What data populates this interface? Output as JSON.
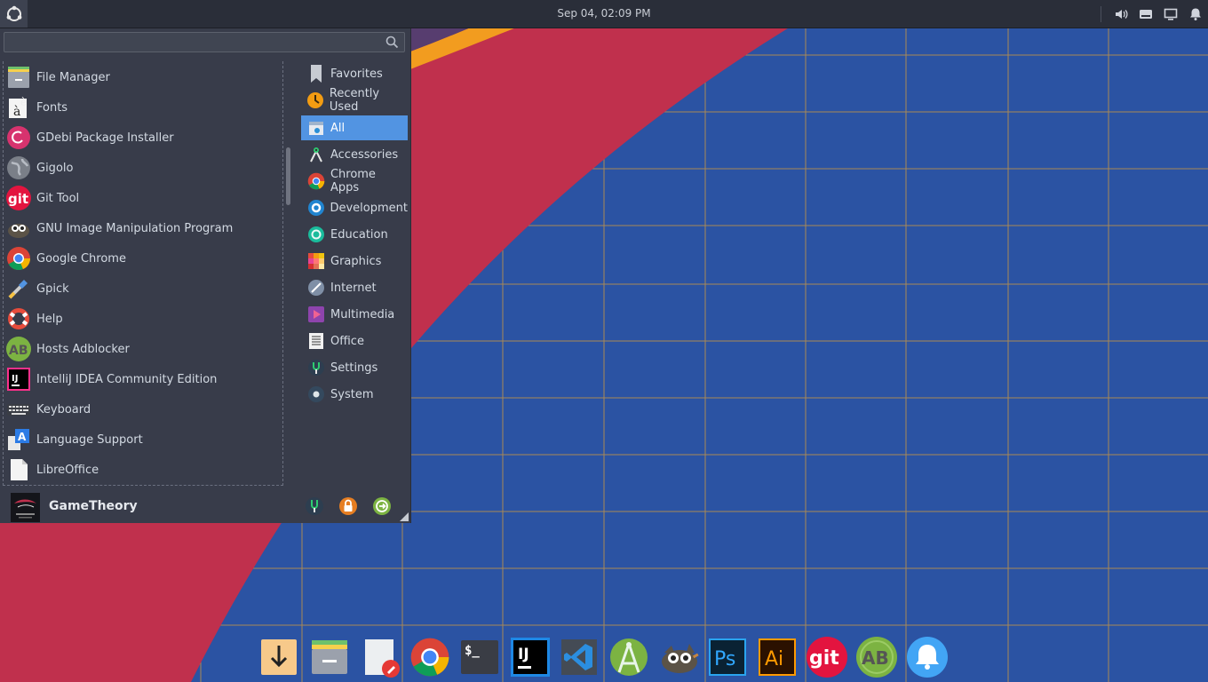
{
  "panel": {
    "clock": "Sep 04, 02:09 PM"
  },
  "search": {
    "value": "",
    "placeholder": ""
  },
  "apps": [
    {
      "label": "File Manager",
      "icon": "file-manager-icon"
    },
    {
      "label": "Fonts",
      "icon": "fonts-icon"
    },
    {
      "label": "GDebi Package Installer",
      "icon": "gdebi-icon"
    },
    {
      "label": "Gigolo",
      "icon": "gigolo-icon"
    },
    {
      "label": "Git Tool",
      "icon": "git-icon"
    },
    {
      "label": "GNU Image Manipulation Program",
      "icon": "gimp-icon"
    },
    {
      "label": "Google Chrome",
      "icon": "chrome-icon"
    },
    {
      "label": "Gpick",
      "icon": "gpick-icon"
    },
    {
      "label": "Help",
      "icon": "help-icon"
    },
    {
      "label": "Hosts Adblocker",
      "icon": "adblocker-icon"
    },
    {
      "label": "IntelliJ IDEA Community Edition",
      "icon": "intellij-icon"
    },
    {
      "label": "Keyboard",
      "icon": "keyboard-icon"
    },
    {
      "label": "Language Support",
      "icon": "language-icon"
    },
    {
      "label": "LibreOffice",
      "icon": "libreoffice-icon"
    }
  ],
  "categories": [
    {
      "label": "Favorites",
      "icon": "bookmark-icon"
    },
    {
      "label": "Recently Used",
      "icon": "recent-icon"
    },
    {
      "label": "All",
      "icon": "all-apps-icon",
      "selected": true
    },
    {
      "label": "Accessories",
      "icon": "accessories-icon"
    },
    {
      "label": "Chrome Apps",
      "icon": "chrome-icon"
    },
    {
      "label": "Development",
      "icon": "development-icon"
    },
    {
      "label": "Education",
      "icon": "education-icon"
    },
    {
      "label": "Graphics",
      "icon": "graphics-icon"
    },
    {
      "label": "Internet",
      "icon": "internet-icon"
    },
    {
      "label": "Multimedia",
      "icon": "multimedia-icon"
    },
    {
      "label": "Office",
      "icon": "office-icon"
    },
    {
      "label": "Settings",
      "icon": "settings-icon"
    },
    {
      "label": "System",
      "icon": "system-icon"
    }
  ],
  "user": {
    "name": "GameTheory"
  },
  "dock": [
    "downloads-icon",
    "file-manager-icon",
    "text-editor-icon",
    "chrome-icon",
    "terminal-icon",
    "intellij-icon",
    "vscode-icon",
    "android-studio-icon",
    "gimp-icon",
    "photoshop-icon",
    "illustrator-icon",
    "git-icon",
    "adblocker-icon",
    "notifications-icon"
  ],
  "dock_text": {
    "terminal": "$_",
    "intellij": "IJ",
    "photoshop": "Ps",
    "illustrator": "Ai",
    "git": "git",
    "adblocker": "AB"
  },
  "colors": {
    "panel": "#2a2e39",
    "menu": "#383c4a",
    "accent": "#5294e2",
    "wallpaper_blue": "#2b53a3",
    "wallpaper_red": "#c0304d",
    "wallpaper_orange": "#f29c1f"
  }
}
